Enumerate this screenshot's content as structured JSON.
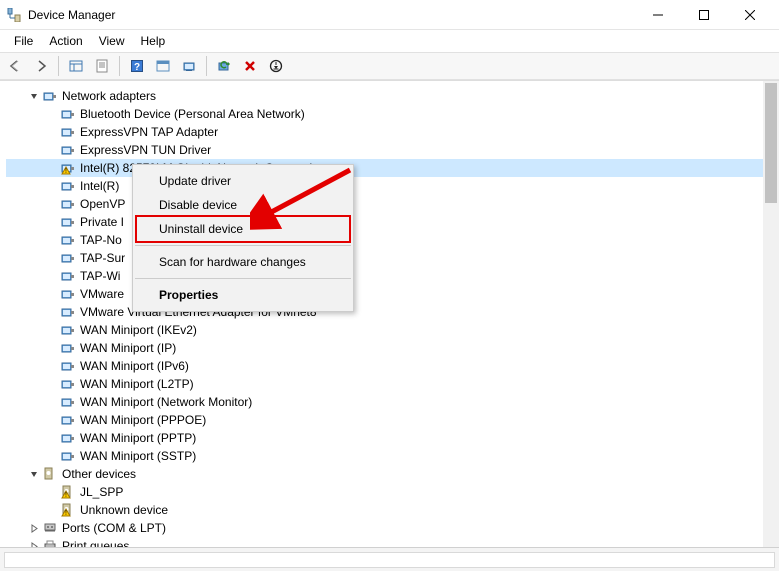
{
  "title": "Device Manager",
  "menu": {
    "file": "File",
    "action": "Action",
    "view": "View",
    "help": "Help"
  },
  "tree": {
    "network_adapters": "Network adapters",
    "items": [
      "Bluetooth Device (Personal Area Network)",
      "ExpressVPN TAP Adapter",
      "ExpressVPN TUN Driver",
      "Intel(R) 82579LM Gigabit Network Connection",
      "Intel(R)",
      "OpenVP",
      "Private I",
      "TAP-No",
      "TAP-Sur",
      "TAP-Wi",
      "VMware",
      "VMware Virtual Ethernet Adapter for VMnet8",
      "WAN Miniport (IKEv2)",
      "WAN Miniport (IP)",
      "WAN Miniport (IPv6)",
      "WAN Miniport (L2TP)",
      "WAN Miniport (Network Monitor)",
      "WAN Miniport (PPPOE)",
      "WAN Miniport (PPTP)",
      "WAN Miniport (SSTP)"
    ],
    "selected_index": 3,
    "warning_index": 3,
    "other_devices": "Other devices",
    "other_items": [
      "JL_SPP",
      "Unknown device"
    ],
    "ports": "Ports (COM & LPT)",
    "print_queues": "Print queues"
  },
  "context_menu": {
    "update": "Update driver",
    "disable": "Disable device",
    "uninstall": "Uninstall device",
    "scan": "Scan for hardware changes",
    "properties": "Properties"
  }
}
